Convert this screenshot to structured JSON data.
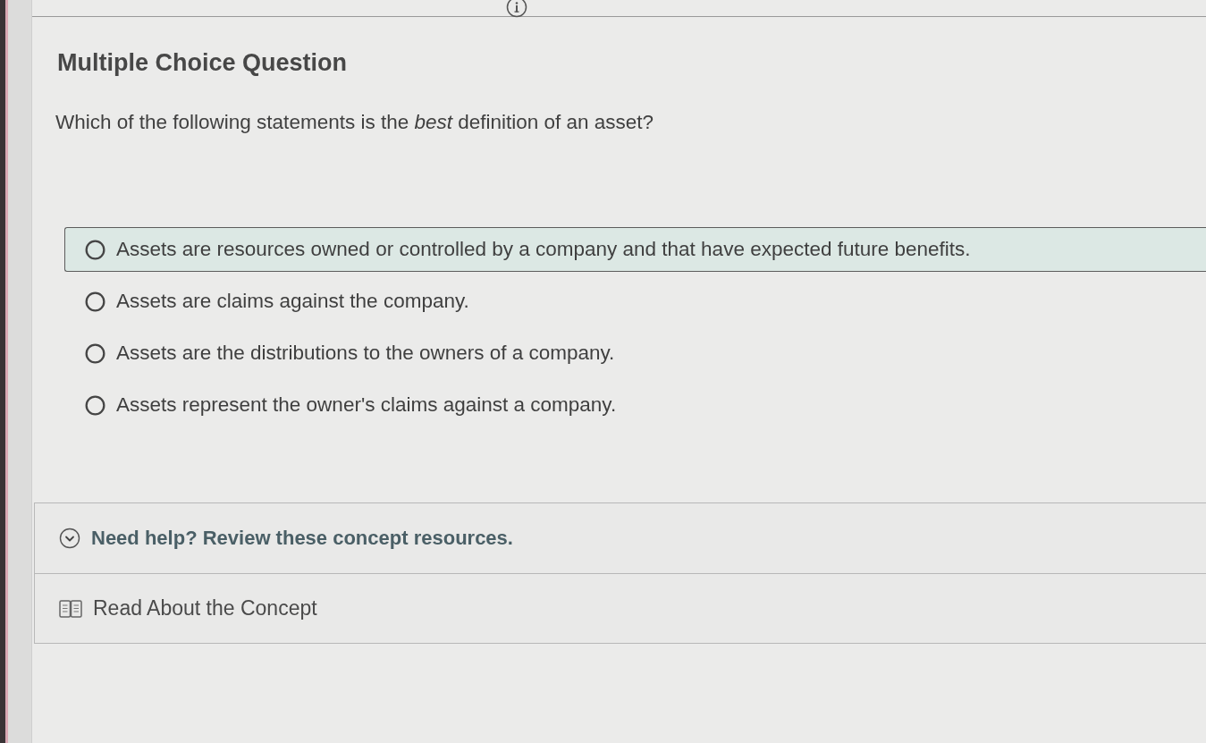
{
  "question": {
    "type_label": "Multiple Choice Question",
    "prompt": "Which of the following statements is the *best* definition of an asset?"
  },
  "options": [
    {
      "text": "Assets are resources owned or controlled by a company and that have expected future benefits.",
      "selected": false,
      "hovered": true
    },
    {
      "text": "Assets are claims against the company.",
      "selected": false,
      "hovered": false
    },
    {
      "text": "Assets are the distributions to the owners of a company.",
      "selected": false,
      "hovered": false
    },
    {
      "text": "Assets represent the owner's claims against a company.",
      "selected": false,
      "hovered": false
    }
  ],
  "help": {
    "title": "Need help? Review these concept resources.",
    "expanded": true,
    "resources": [
      {
        "label": "Read About the Concept"
      }
    ]
  }
}
